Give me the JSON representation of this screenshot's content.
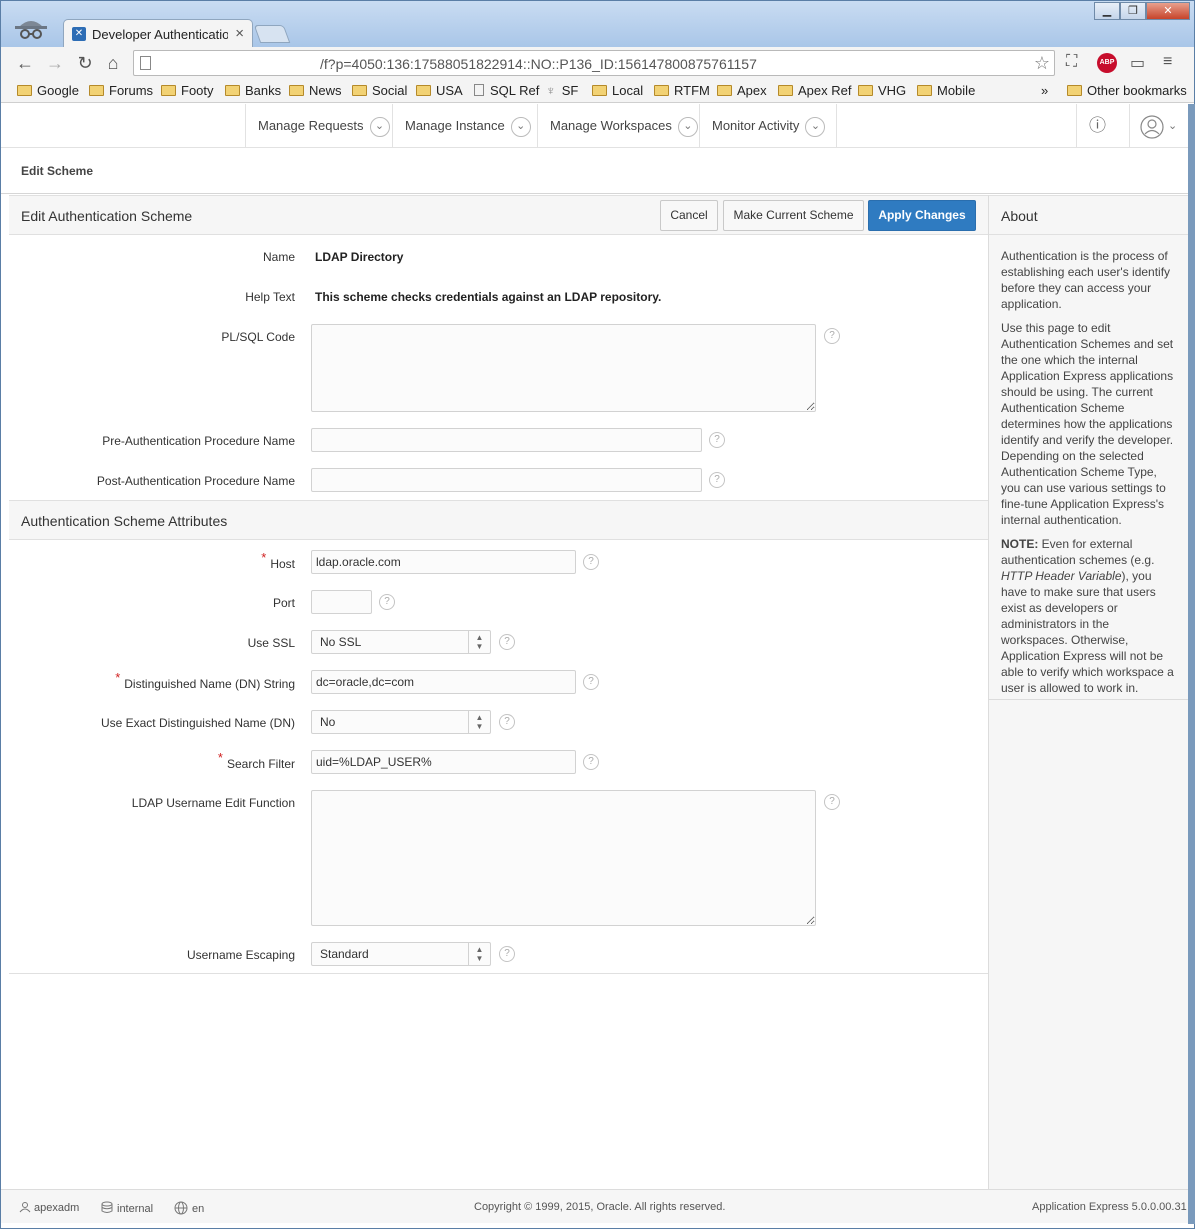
{
  "browser": {
    "tab_title": "Developer Authentication",
    "url": "/f?p=4050:136:17588051822914::NO::P136_ID:156147800875761157",
    "abp_label": "ABP",
    "bookmarks": [
      "Google",
      "Forums",
      "Footy",
      "Banks",
      "News",
      "Social",
      "USA",
      "SQL Ref",
      "SF",
      "Local",
      "RTFM",
      "Apex",
      "Apex Ref",
      "VHG",
      "Mobile"
    ],
    "bookmarks_overflow": "»",
    "other_bookmarks": "Other bookmarks"
  },
  "apex_header": {
    "menus": [
      "Manage Requests",
      "Manage Instance",
      "Manage Workspaces",
      "Monitor Activity"
    ]
  },
  "page": {
    "title": "Edit Scheme"
  },
  "region1": {
    "title": "Edit Authentication Scheme",
    "buttons": {
      "cancel": "Cancel",
      "make_current": "Make Current Scheme",
      "apply": "Apply Changes"
    },
    "fields": {
      "name_label": "Name",
      "name_value": "LDAP Directory",
      "help_label": "Help Text",
      "help_value": "This scheme checks credentials against an LDAP repository.",
      "plsql_label": "PL/SQL Code",
      "plsql_value": "",
      "pre_auth_label": "Pre-Authentication Procedure Name",
      "pre_auth_value": "",
      "post_auth_label": "Post-Authentication Procedure Name",
      "post_auth_value": ""
    }
  },
  "region2": {
    "title": "Authentication Scheme Attributes",
    "required_mark": "*",
    "fields": {
      "host_label": "Host",
      "host_value": "ldap.oracle.com",
      "port_label": "Port",
      "port_value": "",
      "ssl_label": "Use SSL",
      "ssl_value": "No SSL",
      "dn_label": "Distinguished Name (DN) String",
      "dn_value": "dc=oracle,dc=com",
      "exact_dn_label": "Use Exact Distinguished Name (DN)",
      "exact_dn_value": "No",
      "search_label": "Search Filter",
      "search_value": "uid=%LDAP_USER%",
      "edit_fn_label": "LDAP Username Edit Function",
      "edit_fn_value": "",
      "escaping_label": "Username Escaping",
      "escaping_value": "Standard"
    }
  },
  "about": {
    "title": "About",
    "p1": "Authentication is the process of establishing each user's identify before they can access your application.",
    "p2": "Use this page to edit Authentication Schemes and set the one which the internal Application Express applications should be using. The current Authentication Scheme determines how the applications identify and verify the developer. Depending on the selected Authentication Scheme Type, you can use various settings to fine-tune Application Express's internal authentication.",
    "note_label": "NOTE:",
    "p3_a": " Even for external authentication schemes (e.g. ",
    "p3_em": "HTTP Header Variable",
    "p3_b": "), you have to make sure that users exist as developers or administrators in the workspaces. Otherwise, Application Express will not be able to verify which workspace a user is allowed to work in."
  },
  "footer": {
    "user": "apexadm",
    "workspace": "internal",
    "language": "en",
    "copyright": "Copyright © 1999, 2015, Oracle. All rights reserved.",
    "version": "Application Express 5.0.0.00.31"
  },
  "colors": {
    "accent": "#2f7bc1",
    "required": "#d02020"
  }
}
